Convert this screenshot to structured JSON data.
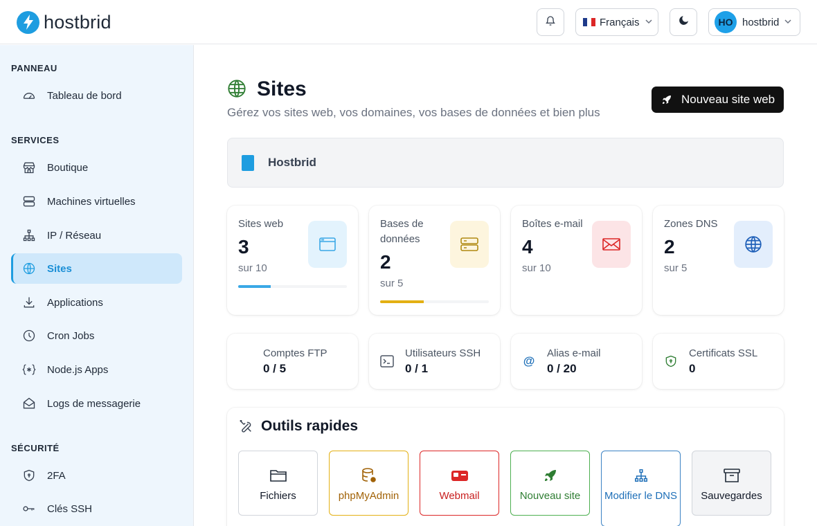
{
  "header": {
    "brand": "hostbrid",
    "language": "Français",
    "user_initials": "HO",
    "user_name": "hostbrid"
  },
  "sidebar": {
    "sections": [
      {
        "title": "PANNEAU"
      },
      {
        "title": "SERVICES"
      },
      {
        "title": "SÉCURITÉ"
      }
    ],
    "items": [
      {
        "label": "Tableau de bord",
        "icon": "gauge-icon"
      },
      {
        "label": "Boutique",
        "icon": "store-icon"
      },
      {
        "label": "Machines virtuelles",
        "icon": "server-icon"
      },
      {
        "label": "IP / Réseau",
        "icon": "network-icon"
      },
      {
        "label": "Sites",
        "icon": "globe-icon",
        "active": true
      },
      {
        "label": "Applications",
        "icon": "download-icon"
      },
      {
        "label": "Cron Jobs",
        "icon": "clock-icon"
      },
      {
        "label": "Node.js Apps",
        "icon": "braces-icon"
      },
      {
        "label": "Logs de messagerie",
        "icon": "mail-open-icon"
      },
      {
        "label": "2FA",
        "icon": "shield-icon"
      },
      {
        "label": "Clés SSH",
        "icon": "key-icon"
      }
    ]
  },
  "main": {
    "title": "Sites",
    "subtitle": "Gérez vos sites web, vos domaines, vos bases de données et bien plus",
    "new_site_button": "Nouveau site web",
    "account_name": "Hostbrid",
    "stats": [
      {
        "label": "Sites web",
        "value": "3",
        "sub": "sur 10",
        "progress": 0.3,
        "color": "#3aa8e6"
      },
      {
        "label": "Bases de données",
        "value": "2",
        "sub": "sur 5",
        "progress": 0.4,
        "color": "#e3b013"
      },
      {
        "label": "Boîtes e-mail",
        "value": "4",
        "sub": "sur 10"
      },
      {
        "label": "Zones DNS",
        "value": "2",
        "sub": "sur 5"
      }
    ],
    "mini_stats": [
      {
        "label": "Comptes FTP",
        "value": "0 / 5"
      },
      {
        "label": "Utilisateurs SSH",
        "value": "0 / 1"
      },
      {
        "label": "Alias e-mail",
        "value": "0 / 20"
      },
      {
        "label": "Certificats SSL",
        "value": "0"
      }
    ],
    "tools_title": "Outils rapides",
    "tools": [
      {
        "label": "Fichiers",
        "color": "#111827"
      },
      {
        "label": "phpMyAdmin",
        "color": "#a16207"
      },
      {
        "label": "Webmail",
        "color": "#c81e1e"
      },
      {
        "label": "Nouveau site",
        "color": "#2e7d32"
      },
      {
        "label": "Modifier le DNS",
        "color": "#1e6fb8"
      },
      {
        "label": "Sauvegardes",
        "color": "#111827"
      }
    ]
  }
}
